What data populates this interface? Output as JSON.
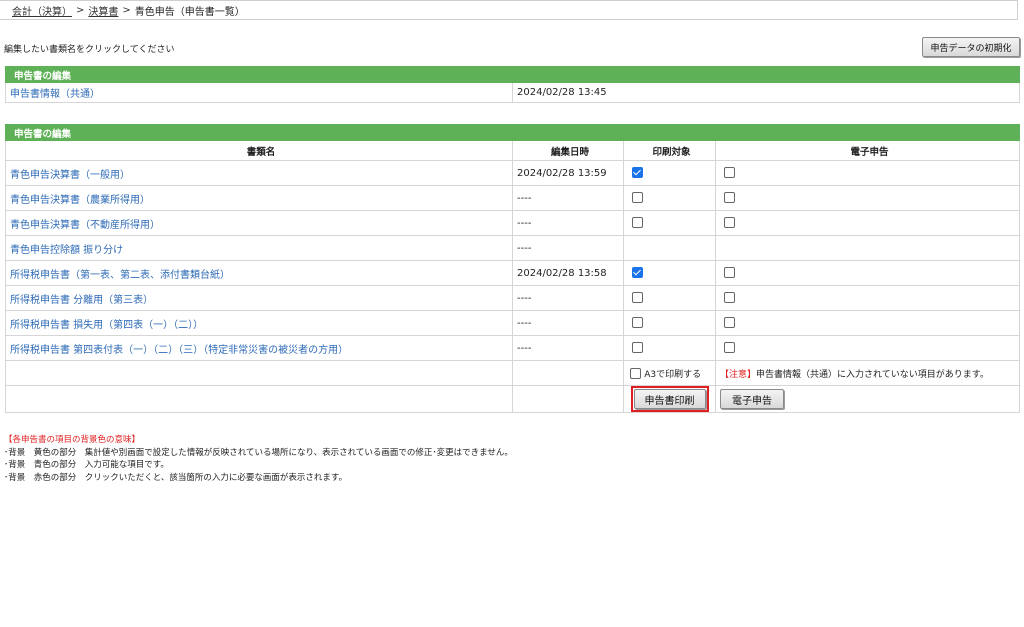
{
  "breadcrumb": {
    "item1": "会計（決算）",
    "sep1": ">",
    "item2": "決算書",
    "sep2": ">",
    "current": "青色申告（申告書一覧）"
  },
  "instruction": "編集したい書類名をクリックしてください",
  "init_button": "申告データの初期化",
  "section1": {
    "title": "申告書の編集",
    "row": {
      "name": "申告書情報（共通）",
      "datetime": "2024/02/28 13:45"
    }
  },
  "section2": {
    "title": "申告書の編集",
    "headers": {
      "name": "書類名",
      "datetime": "編集日時",
      "print": "印刷対象",
      "efile": "電子申告"
    },
    "rows": [
      {
        "name": "青色申告決算書（一般用）",
        "datetime": "2024/02/28 13:59",
        "print": true,
        "efile": false
      },
      {
        "name": "青色申告決算書（農業所得用）",
        "datetime": "----",
        "print": false,
        "efile": false
      },
      {
        "name": "青色申告決算書（不動産所得用）",
        "datetime": "----",
        "print": false,
        "efile": false
      },
      {
        "name": "青色申告控除額 振り分け",
        "datetime": "----"
      },
      {
        "name": "所得税申告書（第一表、第二表、添付書類台紙）",
        "datetime": "2024/02/28 13:58",
        "print": true,
        "efile": false
      },
      {
        "name": "所得税申告書 分離用（第三表）",
        "datetime": "----",
        "print": false,
        "efile": false
      },
      {
        "name": "所得税申告書 損失用（第四表（一）（二））",
        "datetime": "----",
        "print": false,
        "efile": false
      },
      {
        "name": "所得税申告書 第四表付表（一）（二）（三）（特定非常災害の被災者の方用）",
        "datetime": "----",
        "print": false,
        "efile": false
      }
    ],
    "a3_label": "A3で印刷する",
    "note_tag": "【注意】",
    "note_text": "申告書情報（共通）に入力されていない項目があります。",
    "print_button": "申告書印刷",
    "efile_button": "電子申告"
  },
  "legend": {
    "title": "【各申告書の項目の背景色の意味】",
    "lines": [
      "･背景　黄色の部分　集計値や別画面で設定した情報が反映されている場所になり、表示されている画面での修正･変更はできません。",
      "･背景　青色の部分　入力可能な項目です。",
      "･背景　赤色の部分　クリックいただくと、該当箇所の入力に必要な画面が表示されます。"
    ]
  }
}
